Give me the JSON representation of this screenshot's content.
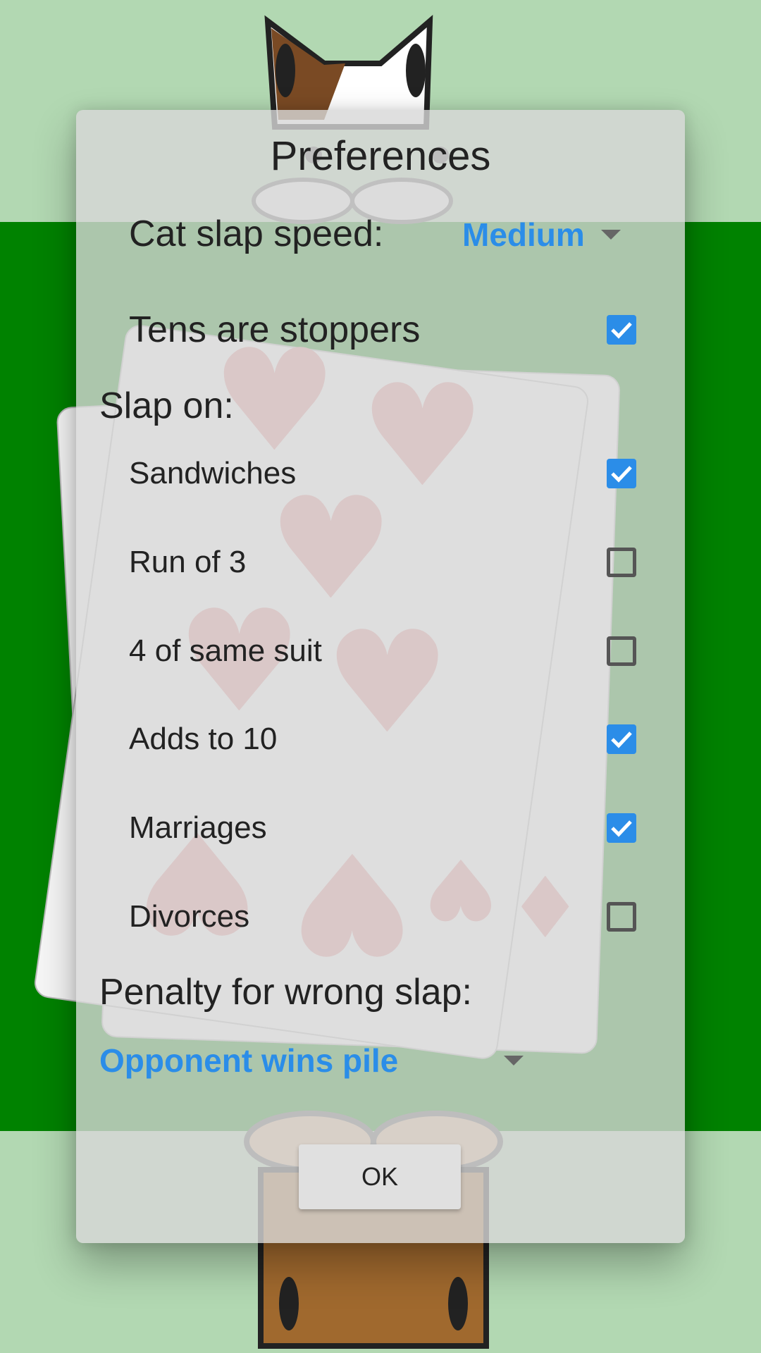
{
  "dialog": {
    "title": "Preferences",
    "cat_slap_speed": {
      "label": "Cat slap speed:",
      "value": "Medium"
    },
    "tens_are_stoppers": {
      "label": "Tens are stoppers",
      "checked": true
    },
    "slap_on_header": "Slap on:",
    "slap_on_items": [
      {
        "label": "Sandwiches",
        "checked": true
      },
      {
        "label": "Run of 3",
        "checked": false
      },
      {
        "label": "4 of same suit",
        "checked": false
      },
      {
        "label": "Adds to 10",
        "checked": true
      },
      {
        "label": "Marriages",
        "checked": true
      },
      {
        "label": "Divorces",
        "checked": false
      }
    ],
    "penalty_header": "Penalty for wrong slap:",
    "penalty_value": "Opponent wins pile",
    "ok_label": "OK"
  },
  "colors": {
    "felt": "#008200",
    "accent": "#2b8de8",
    "heart": "#e38a8a"
  },
  "icons": [
    "cat-head-icon",
    "cat-paws-icon",
    "checkmark-icon",
    "caret-down-icon"
  ]
}
